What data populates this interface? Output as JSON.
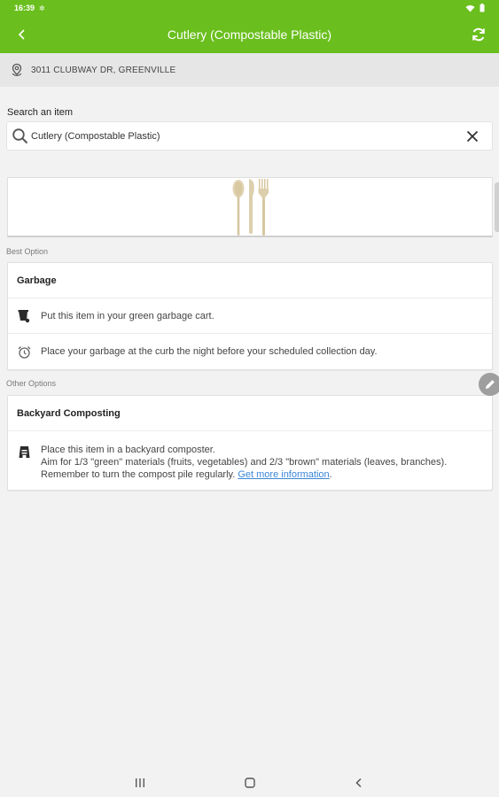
{
  "status_bar": {
    "time": "16:39",
    "notification_icon": "sync-dot-icon"
  },
  "app_bar": {
    "title": "Cutlery (Compostable Plastic)",
    "back_icon": "chevron-left-icon",
    "refresh_icon": "refresh-icon"
  },
  "address": {
    "text": "3011 CLUBWAY DR, GREENVILLE",
    "icon": "location-pin-icon"
  },
  "search": {
    "label": "Search an item",
    "value": "Cutlery (Compostable Plastic)",
    "placeholder": "Search an item"
  },
  "best_option": {
    "section_label": "Best Option",
    "title": "Garbage",
    "rows": [
      {
        "icon": "garbage-cart-icon",
        "text": "Put this item in your green garbage cart."
      },
      {
        "icon": "alarm-clock-icon",
        "text": "Place your garbage at the curb the night before your scheduled collection day."
      }
    ]
  },
  "other_options": {
    "section_label": "Other Options",
    "title": "Backyard Composting",
    "row": {
      "icon": "composter-icon",
      "line1": "Place this item in a backyard composter.",
      "line2": "Aim for 1/3 \"green\" materials (fruits, vegetables) and 2/3 \"brown\" materials (leaves, branches). Remember to turn the compost pile regularly. ",
      "link": "Get more information",
      "link_suffix": "."
    }
  },
  "colors": {
    "brand": "#6abf1e",
    "link": "#3a86d8"
  }
}
